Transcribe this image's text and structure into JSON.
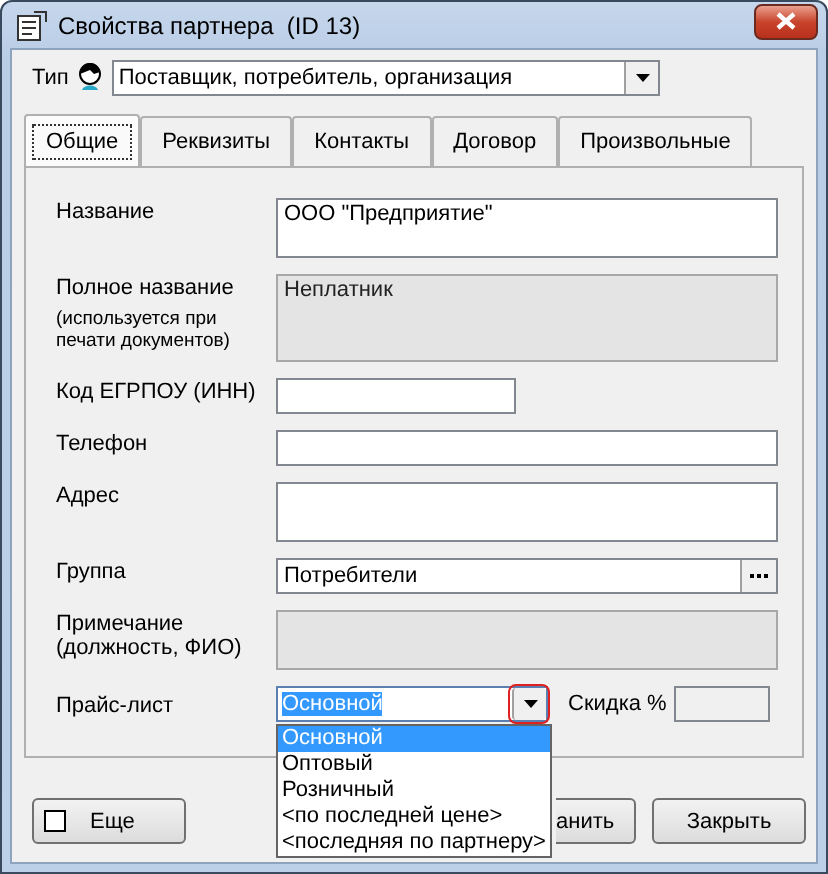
{
  "window": {
    "title": "Свойства партнера  (ID 13)"
  },
  "type": {
    "label": "Тип",
    "value": "Поставщик, потребитель, организация"
  },
  "tabs": [
    {
      "label": "Общие",
      "selected": true
    },
    {
      "label": "Реквизиты",
      "selected": false
    },
    {
      "label": "Контакты",
      "selected": false
    },
    {
      "label": "Договор",
      "selected": false
    },
    {
      "label": "Произвольные",
      "selected": false
    }
  ],
  "fields": [
    {
      "kind": "area",
      "label": "Название",
      "value": "ООО \"Предприятие\"",
      "readonly": false
    },
    {
      "kind": "big-area",
      "label": "Полное название",
      "note": "(используется при печати документов)",
      "value": "Неплатник",
      "readonly": true
    },
    {
      "kind": "short",
      "label": "Код ЕГРПОУ (ИНН)",
      "readonly": false
    },
    {
      "kind": "line",
      "label": "Телефон",
      "readonly": false
    },
    {
      "kind": "area",
      "label": "Адрес",
      "readonly": false
    },
    {
      "kind": "picker",
      "label": "Группа",
      "value": "Потребители",
      "readonly": false
    },
    {
      "kind": "area",
      "label": "Примечание (должность, ФИО)",
      "readonly": true
    }
  ],
  "price_list": {
    "label": "Прайс-лист",
    "value": "Основной",
    "expanded": true,
    "highlighted": true,
    "options": [
      {
        "label": "Основной",
        "selected": true
      },
      {
        "label": "Оптовый",
        "selected": false
      },
      {
        "label": "Розничный",
        "selected": false
      },
      {
        "label": "<по последней цене>",
        "selected": false
      },
      {
        "label": "<последняя по партнеру>",
        "selected": false
      }
    ]
  },
  "discount": {
    "label": "Скидка %"
  },
  "more": {
    "label": "Еще",
    "checked": false
  },
  "buttons": [
    {
      "label": "анить"
    },
    {
      "label": "Закрыть"
    }
  ]
}
